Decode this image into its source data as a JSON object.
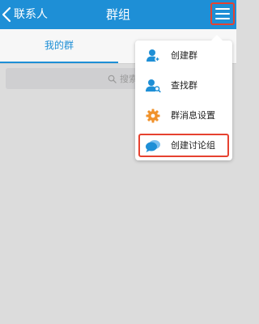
{
  "header": {
    "back_label": "联系人",
    "title": "群组",
    "back_icon": "chevron-left-icon",
    "menu_icon": "hamburger-menu-icon"
  },
  "tabs": [
    {
      "label": "我的群",
      "active": true
    }
  ],
  "search": {
    "placeholder": "搜索",
    "icon": "search-icon"
  },
  "dropdown_menu": {
    "items": [
      {
        "label": "创建群",
        "icon": "person-add-icon",
        "icon_color": "#1e8fd6"
      },
      {
        "label": "查找群",
        "icon": "find-group-icon",
        "icon_color": "#1e8fd6"
      },
      {
        "label": "群消息设置",
        "icon": "gear-icon",
        "icon_color": "#f0922b"
      },
      {
        "label": "创建讨论组",
        "icon": "chat-bubbles-icon",
        "icon_color": "#1e8fd6",
        "highlighted": true
      }
    ]
  },
  "colors": {
    "header_bg": "#1e8fd6",
    "accent": "#1e8fd6",
    "highlight_border": "#e64230",
    "background": "#dcdcdc"
  }
}
